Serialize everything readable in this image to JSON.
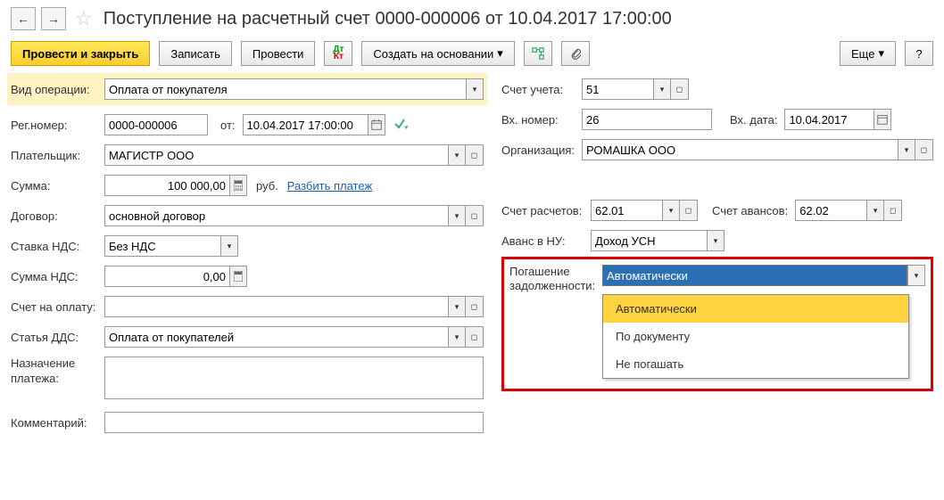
{
  "header": {
    "title": "Поступление на расчетный счет 0000-000006 от 10.04.2017 17:00:00"
  },
  "toolbar": {
    "post_close": "Провести и закрыть",
    "save": "Записать",
    "post": "Провести",
    "create_based": "Создать на основании",
    "more": "Еще"
  },
  "left": {
    "op_type_lbl": "Вид операции:",
    "op_type_val": "Оплата от покупателя",
    "reg_no_lbl": "Рег.номер:",
    "reg_no_val": "0000-000006",
    "from_lbl": "от:",
    "date_val": "10.04.2017 17:00:00",
    "payer_lbl": "Плательщик:",
    "payer_val": "МАГИСТР ООО",
    "sum_lbl": "Сумма:",
    "sum_val": "100 000,00",
    "rub": "руб.",
    "split": "Разбить платеж",
    "contract_lbl": "Договор:",
    "contract_val": "основной договор",
    "vat_rate_lbl": "Ставка НДС:",
    "vat_rate_val": "Без НДС",
    "vat_sum_lbl": "Сумма НДС:",
    "vat_sum_val": "0,00",
    "invoice_lbl": "Счет на оплату:",
    "dds_lbl": "Статья ДДС:",
    "dds_val": "Оплата от покупателей",
    "purpose_lbl": "Назначение платежа:",
    "comment_lbl": "Комментарий:"
  },
  "right": {
    "account_lbl": "Счет учета:",
    "account_val": "51",
    "in_no_lbl": "Вх. номер:",
    "in_no_val": "26",
    "in_date_lbl": "Вх. дата:",
    "in_date_val": "10.04.2017",
    "org_lbl": "Организация:",
    "org_val": "РОМАШКА ООО",
    "settle_lbl": "Счет расчетов:",
    "settle_val": "62.01",
    "advance_lbl": "Счет авансов:",
    "advance_val": "62.02",
    "avans_nu_lbl": "Аванс в НУ:",
    "avans_nu_val": "Доход УСН",
    "debt_lbl": "Погашение задолженности:",
    "debt_val": "Автоматически",
    "options": [
      "Автоматически",
      "По документу",
      "Не погашать"
    ]
  }
}
